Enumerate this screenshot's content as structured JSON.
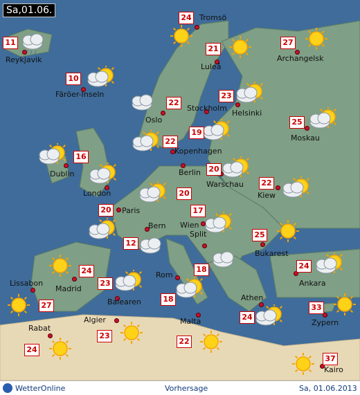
{
  "date": "Sa,01.06.",
  "footer": {
    "brand": "WetterOnline",
    "center": "Vorhersage",
    "right": "Sa, 01.06.2013"
  },
  "cities": [
    {
      "name": "Tromsö",
      "temp": "24",
      "icon": "sun-icon"
    },
    {
      "name": "Reykjavik",
      "temp": "11",
      "icon": "rain-cloud-icon"
    },
    {
      "name": "Luleå",
      "temp": "21",
      "icon": "sun-icon"
    },
    {
      "name": "Archangelsk",
      "temp": "27",
      "icon": "sun-icon"
    },
    {
      "name": "Färöer-Inseln",
      "temp": "10",
      "icon": "partly-cloudy-icon"
    },
    {
      "name": "Helsinki",
      "temp": "23",
      "icon": "partly-cloudy-icon"
    },
    {
      "name": "Oslo",
      "temp": "22",
      "icon": "rain-cloud-icon"
    },
    {
      "name": "Stockholm",
      "temp": "19",
      "icon": "partly-cloudy-icon"
    },
    {
      "name": "Moskau",
      "temp": "25",
      "icon": "partly-cloudy-icon"
    },
    {
      "name": "Kopenhagen",
      "temp": "22",
      "icon": "partly-cloudy-icon"
    },
    {
      "name": "Dublin",
      "temp": "16",
      "icon": "partly-cloudy-icon"
    },
    {
      "name": "Berlin",
      "temp": "20",
      "icon": "partly-cloudy-icon"
    },
    {
      "name": "Warschau",
      "temp": "20",
      "icon": "partly-cloudy-icon"
    },
    {
      "name": "London",
      "temp": "",
      "icon": "partly-cloudy-icon"
    },
    {
      "name": "Kiew",
      "temp": "22",
      "icon": "partly-cloudy-icon"
    },
    {
      "name": "Paris",
      "temp": "20",
      "icon": "partly-cloudy-icon"
    },
    {
      "name": "Bern",
      "temp": "12",
      "icon": "rain-cloud-icon"
    },
    {
      "name": "Wien",
      "temp": "17",
      "icon": "partly-cloudy-icon"
    },
    {
      "name": "Bukarest",
      "temp": "25",
      "icon": "sun-icon"
    },
    {
      "name": "Split",
      "temp": "18",
      "icon": "cloud-icon"
    },
    {
      "name": "Lissabon",
      "temp": "27",
      "icon": "sun-icon"
    },
    {
      "name": "Madrid",
      "temp": "24",
      "icon": "sun-icon"
    },
    {
      "name": "Rom",
      "temp": "18",
      "icon": "partly-cloudy-icon"
    },
    {
      "name": "Ankara",
      "temp": "24",
      "icon": "partly-cloudy-icon"
    },
    {
      "name": "Balearen",
      "temp": "23",
      "icon": "partly-cloudy-icon"
    },
    {
      "name": "Athen",
      "temp": "24",
      "icon": "partly-cloudy-icon"
    },
    {
      "name": "Zypern",
      "temp": "33",
      "icon": "sun-icon"
    },
    {
      "name": "Algier",
      "temp": "23",
      "icon": "sun-icon"
    },
    {
      "name": "Malta",
      "temp": "22",
      "icon": "sun-icon"
    },
    {
      "name": "Rabat",
      "temp": "24",
      "icon": "sun-icon"
    },
    {
      "name": "Kairo",
      "temp": "37",
      "icon": "sun-icon"
    }
  ]
}
